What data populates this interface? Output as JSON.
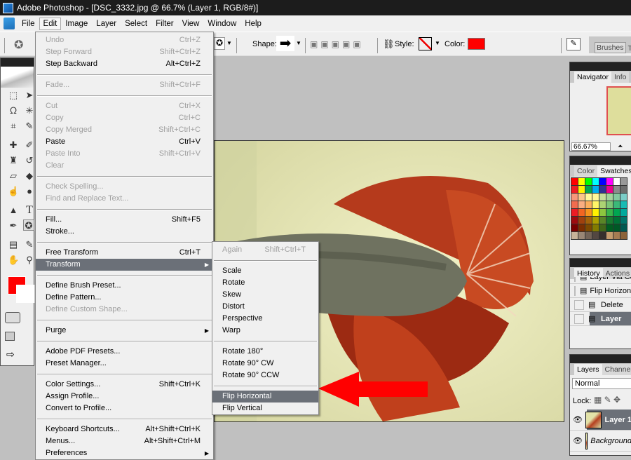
{
  "window": {
    "title": "Adobe Photoshop - [DSC_3332.jpg @ 66.7% (Layer 1, RGB/8#)]"
  },
  "menubar": [
    "File",
    "Edit",
    "Image",
    "Layer",
    "Select",
    "Filter",
    "View",
    "Window",
    "Help"
  ],
  "options": {
    "shape_label": "Shape:",
    "style_label": "Style:",
    "color_label": "Color:",
    "color": "#ff0000",
    "brushes_tab": "Brushes",
    "next_tab": "T"
  },
  "edit_menu": [
    {
      "label": "Undo",
      "shortcut": "Ctrl+Z",
      "disabled": true
    },
    {
      "label": "Step Forward",
      "shortcut": "Shift+Ctrl+Z",
      "disabled": true
    },
    {
      "label": "Step Backward",
      "shortcut": "Alt+Ctrl+Z"
    },
    {
      "sep": true
    },
    {
      "label": "Fade...",
      "shortcut": "Shift+Ctrl+F",
      "disabled": true
    },
    {
      "sep": true
    },
    {
      "label": "Cut",
      "shortcut": "Ctrl+X",
      "disabled": true
    },
    {
      "label": "Copy",
      "shortcut": "Ctrl+C",
      "disabled": true
    },
    {
      "label": "Copy Merged",
      "shortcut": "Shift+Ctrl+C",
      "disabled": true
    },
    {
      "label": "Paste",
      "shortcut": "Ctrl+V"
    },
    {
      "label": "Paste Into",
      "shortcut": "Shift+Ctrl+V",
      "disabled": true
    },
    {
      "label": "Clear",
      "disabled": true
    },
    {
      "sep": true
    },
    {
      "label": "Check Spelling...",
      "disabled": true
    },
    {
      "label": "Find and Replace Text...",
      "disabled": true
    },
    {
      "sep": true
    },
    {
      "label": "Fill...",
      "shortcut": "Shift+F5"
    },
    {
      "label": "Stroke..."
    },
    {
      "sep": true
    },
    {
      "label": "Free Transform",
      "shortcut": "Ctrl+T"
    },
    {
      "label": "Transform",
      "submenu": true,
      "highlighted": true
    },
    {
      "sep": true
    },
    {
      "label": "Define Brush Preset..."
    },
    {
      "label": "Define Pattern..."
    },
    {
      "label": "Define Custom Shape...",
      "disabled": true
    },
    {
      "sep": true
    },
    {
      "label": "Purge",
      "submenu": true
    },
    {
      "sep": true
    },
    {
      "label": "Adobe PDF Presets..."
    },
    {
      "label": "Preset Manager..."
    },
    {
      "sep": true
    },
    {
      "label": "Color Settings...",
      "shortcut": "Shift+Ctrl+K"
    },
    {
      "label": "Assign Profile..."
    },
    {
      "label": "Convert to Profile..."
    },
    {
      "sep": true
    },
    {
      "label": "Keyboard Shortcuts...",
      "shortcut": "Alt+Shift+Ctrl+K"
    },
    {
      "label": "Menus...",
      "shortcut": "Alt+Shift+Ctrl+M"
    },
    {
      "label": "Preferences",
      "submenu": true
    }
  ],
  "transform_menu": [
    {
      "label": "Again",
      "shortcut": "Shift+Ctrl+T",
      "disabled": true
    },
    {
      "sep": true
    },
    {
      "label": "Scale"
    },
    {
      "label": "Rotate"
    },
    {
      "label": "Skew"
    },
    {
      "label": "Distort"
    },
    {
      "label": "Perspective"
    },
    {
      "label": "Warp"
    },
    {
      "sep": true
    },
    {
      "label": "Rotate 180°"
    },
    {
      "label": "Rotate 90° CW"
    },
    {
      "label": "Rotate 90° CCW"
    },
    {
      "sep": true
    },
    {
      "label": "Flip Horizontal",
      "highlighted": true
    },
    {
      "label": "Flip Vertical"
    }
  ],
  "navigator": {
    "tabs": [
      "Navigator",
      "Info"
    ],
    "zoom": "66.67%"
  },
  "swatches": {
    "tabs": [
      "Color",
      "Swatches"
    ],
    "rows": [
      [
        "#ff0000",
        "#ffff00",
        "#00ff00",
        "#00ffff",
        "#0000ff",
        "#ff00ff",
        "#ffffff",
        "#999999"
      ],
      [
        "#ed1c24",
        "#fff200",
        "#00a651",
        "#00aeef",
        "#2e3192",
        "#ec008c",
        "#8c8c8c",
        "#6d6d6d"
      ],
      [
        "#f7977a",
        "#fdc68a",
        "#fff79a",
        "#fff799",
        "#c4df9b",
        "#a3d39c",
        "#82ca9d",
        "#7bcdc8"
      ],
      [
        "#f26c4f",
        "#f9ad81",
        "#fbaf5d",
        "#fff568",
        "#acd373",
        "#7cc576",
        "#3bb878",
        "#1abbb4"
      ],
      [
        "#ed1c24",
        "#f26522",
        "#f7941d",
        "#fff200",
        "#8dc63f",
        "#39b54a",
        "#00a651",
        "#00a99d"
      ],
      [
        "#9e0b0f",
        "#a0410d",
        "#a36209",
        "#aba000",
        "#598527",
        "#197b30",
        "#007236",
        "#00746b"
      ],
      [
        "#790000",
        "#7b2e00",
        "#7d4900",
        "#827b00",
        "#406618",
        "#005e20",
        "#005826",
        "#005952"
      ],
      [
        "#c7b299",
        "#998675",
        "#736357",
        "#534741",
        "#37302d",
        "#c69c6d",
        "#a67c52",
        "#8c6239"
      ]
    ]
  },
  "history": {
    "tabs": [
      "History",
      "Actions"
    ],
    "items": [
      "Layer Via Copy",
      "Flip Horizontal",
      "Delete",
      "Layer"
    ]
  },
  "layers": {
    "tabs": [
      "Layers",
      "Channels"
    ],
    "blend_mode": "Normal",
    "lock_label": "Lock:",
    "items": [
      {
        "name": "Layer 1",
        "selected": true
      },
      {
        "name": "Background",
        "italic": true
      }
    ]
  }
}
